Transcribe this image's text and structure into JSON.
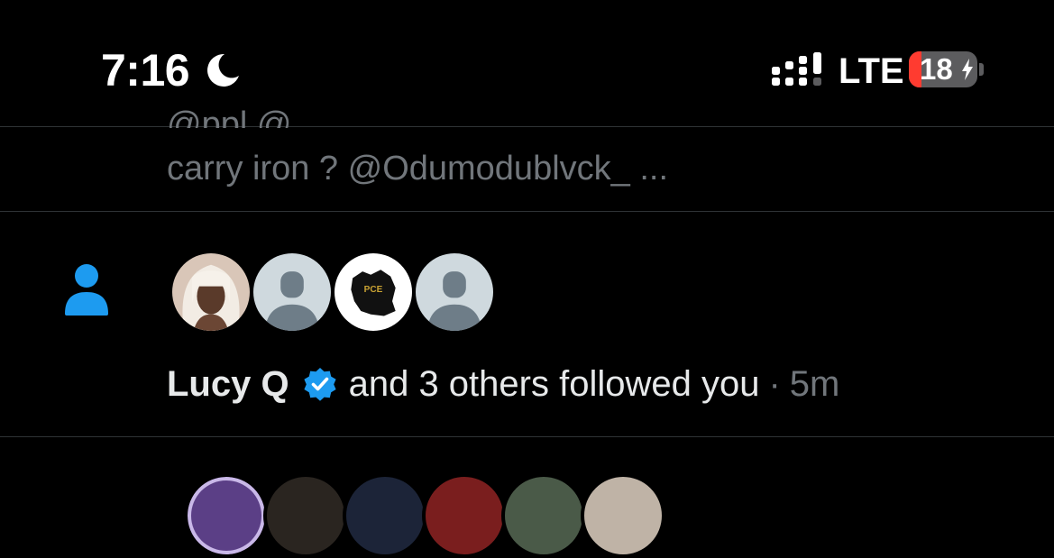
{
  "status_bar": {
    "time": "7:16",
    "focus_icon": "moon-icon",
    "signal_icon": "cellular-signal-icon",
    "network": "LTE",
    "battery_level": "18",
    "battery_percent": 18,
    "charging_icon": "bolt-icon",
    "battery_low_color": "#ff3b30"
  },
  "previous_notification": {
    "snippet": "carry iron ? @Odumodublvck_ ..."
  },
  "follow_notification": {
    "icon": "person-icon",
    "icon_color": "#1d9bf0",
    "avatars": [
      {
        "name": "Lucy Q",
        "kind": "photo"
      },
      {
        "name": "default",
        "kind": "default-avatar"
      },
      {
        "name": "PCE",
        "kind": "logo",
        "logo_text": "PCE"
      },
      {
        "name": "default",
        "kind": "default-avatar"
      }
    ],
    "name": "Lucy Q",
    "verified_icon": "verified-badge-icon",
    "text": "and 3 others followed you",
    "separator": "·",
    "time": "5m"
  },
  "theme": {
    "background": "#000000",
    "primary_text": "#e7e9ea",
    "secondary_text": "#71767b",
    "accent": "#1d9bf0",
    "divider": "#2f3336"
  }
}
